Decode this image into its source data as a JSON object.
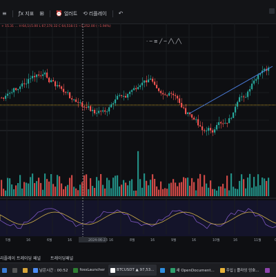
{
  "toolbar": {
    "items": [
      {
        "icon": "fx-icon",
        "label": "지표"
      },
      {
        "icon": "grid-icon",
        "label": ""
      },
      {
        "icon": "clock-alert-icon",
        "label": "얼러트"
      },
      {
        "icon": "replay-icon",
        "label": "리플레이"
      },
      {
        "icon": "undo-icon",
        "label": ""
      }
    ],
    "price_line": "+ 15.31  …  H 64,115.00  L 67,178.32  C 64,518.01  −1,252.00 (−1.94%)"
  },
  "chart": {
    "x_ticks": [
      "5월",
      "16",
      "6월",
      "16",
      "2024-06-23",
      "16",
      "8월",
      "16",
      "9월",
      "16",
      "10월",
      "16",
      "11월",
      "09:"
    ],
    "cursor_date": "2024-06-23"
  },
  "bottom_tabs": [
    "리플레이 트레이딩 패널",
    "트레이딩패널"
  ],
  "taskbar": {
    "items": [
      {
        "label": "",
        "icon": "windows-icon",
        "color": "#3a7bd5"
      },
      {
        "label": "",
        "icon": "search-icon",
        "color": "#555"
      },
      {
        "label": "",
        "icon": "file-explorer-icon",
        "color": "#d9a437"
      },
      {
        "label": "남은시간 : 00:52",
        "icon": "timer-icon",
        "color": "#4c8bf5"
      },
      {
        "label": "fossLauncher",
        "icon": "launcher-icon",
        "color": "#2e7d32"
      },
      {
        "label": "BTCUSDT ▲ 97,53...",
        "icon": "tradingview-icon",
        "color": "#ffffff"
      },
      {
        "label": "",
        "icon": "vscode-icon",
        "color": "#2f8ee0"
      },
      {
        "label": "새 OpenDocument...",
        "icon": "document-icon",
        "color": "#2e9e6b"
      },
      {
        "label": "주입 | 플라잉 엉호...",
        "icon": "chrome-icon",
        "color": "#e8b339"
      },
      {
        "label": "",
        "icon": "app-icon",
        "color": "#8e44ad"
      }
    ]
  }
}
